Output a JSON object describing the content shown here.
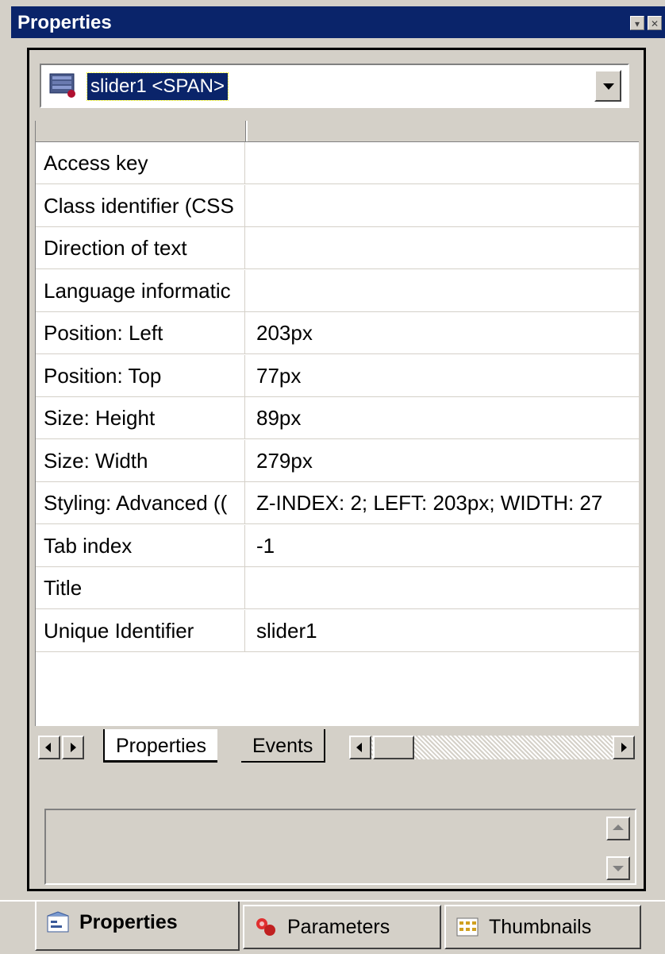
{
  "window": {
    "title": "Properties"
  },
  "selector": {
    "value": "slider1 <SPAN>"
  },
  "properties": [
    {
      "name": "Access key",
      "value": ""
    },
    {
      "name": "Class identifier (CSS",
      "value": ""
    },
    {
      "name": "Direction of text",
      "value": ""
    },
    {
      "name": "Language informatic",
      "value": ""
    },
    {
      "name": "Position: Left",
      "value": "203px"
    },
    {
      "name": "Position: Top",
      "value": "77px"
    },
    {
      "name": "Size: Height",
      "value": "89px"
    },
    {
      "name": "Size: Width",
      "value": "279px"
    },
    {
      "name": "Styling: Advanced ((",
      "value": "Z-INDEX: 2; LEFT: 203px; WIDTH: 27"
    },
    {
      "name": "Tab index",
      "value": "-1"
    },
    {
      "name": "Title",
      "value": ""
    },
    {
      "name": "Unique Identifier",
      "value": "slider1"
    }
  ],
  "grid_tabs": {
    "properties": "Properties",
    "events": "Events"
  },
  "bottom_tabs": {
    "properties": "Properties",
    "parameters": "Parameters",
    "thumbnails": "Thumbnails"
  },
  "colors": {
    "titlebar": "#0a246a",
    "face": "#d4d0c8",
    "selection": "#0a246a"
  }
}
